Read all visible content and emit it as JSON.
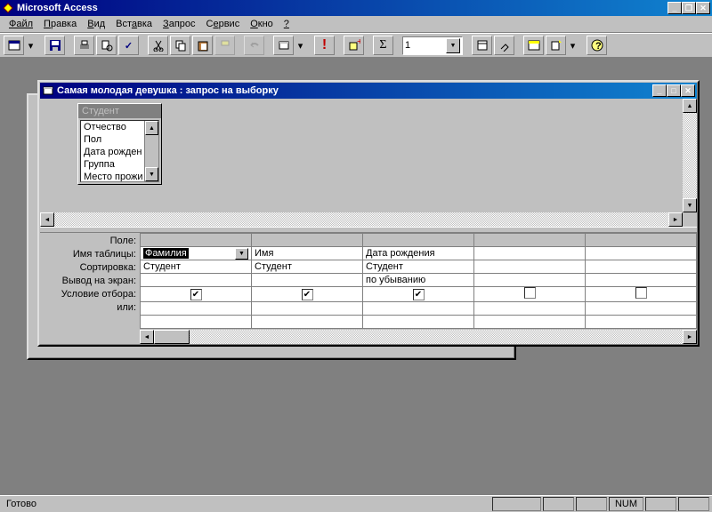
{
  "app": {
    "title": "Microsoft Access"
  },
  "menu": [
    "Файл",
    "Правка",
    "Вид",
    "Вставка",
    "Запрос",
    "Сервис",
    "Окно",
    "?"
  ],
  "toolbar": {
    "combo_value": "1"
  },
  "query_window": {
    "title": "Самая молодая девушка : запрос на выборку",
    "table": {
      "name": "Студент",
      "fields": [
        "Отчество",
        "Пол",
        "Дата рожден",
        "Группа",
        "Место прожи"
      ]
    },
    "rows": {
      "field": "Поле:",
      "table": "Имя таблицы:",
      "sort": "Сортировка:",
      "show": "Вывод на экран:",
      "criteria": "Условие отбора:",
      "or": "или:"
    },
    "cols": [
      {
        "field": "Фамилия",
        "table": "Студент",
        "sort": "",
        "show": true,
        "selected": true
      },
      {
        "field": "Имя",
        "table": "Студент",
        "sort": "",
        "show": true
      },
      {
        "field": "Дата рождения",
        "table": "Студент",
        "sort": "по убыванию",
        "show": true
      },
      {
        "field": "",
        "table": "",
        "sort": "",
        "show": false
      },
      {
        "field": "",
        "table": "",
        "sort": "",
        "show": false
      }
    ]
  },
  "status": {
    "text": "Готово",
    "indicator": "NUM"
  }
}
